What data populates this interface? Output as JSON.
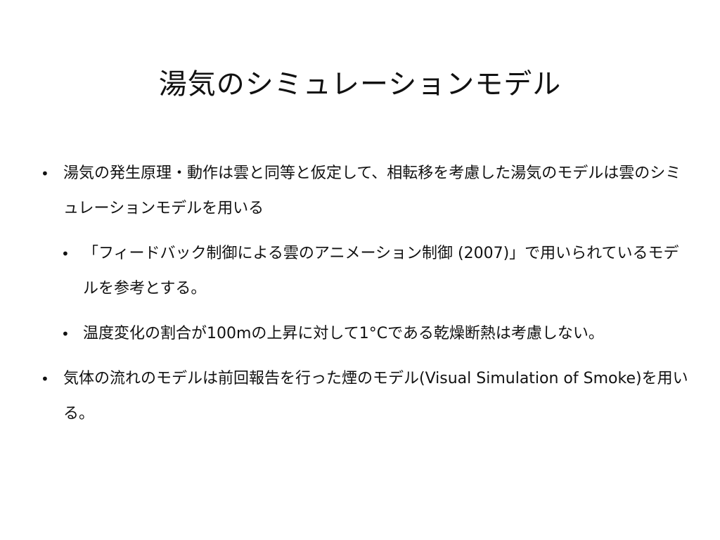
{
  "slide": {
    "title": "湯気のシミュレーションモデル",
    "bullet_glyph": "•",
    "items": [
      {
        "level": 1,
        "text": "湯気の発生原理・動作は雲と同等と仮定して、相転移を考慮した湯気のモデルは雲のシミュレーションモデルを用いる"
      },
      {
        "level": 2,
        "text": "「フィードバック制御による雲のアニメーション制御 (2007)」で用いられているモデルを参考とする。"
      },
      {
        "level": 2,
        "text": "温度変化の割合が100mの上昇に対して1°Cである乾燥断熱は考慮しない。"
      },
      {
        "level": 1,
        "text": "気体の流れのモデルは前回報告を行った煙のモデル(Visual Simulation of Smoke)を用いる。"
      }
    ]
  }
}
